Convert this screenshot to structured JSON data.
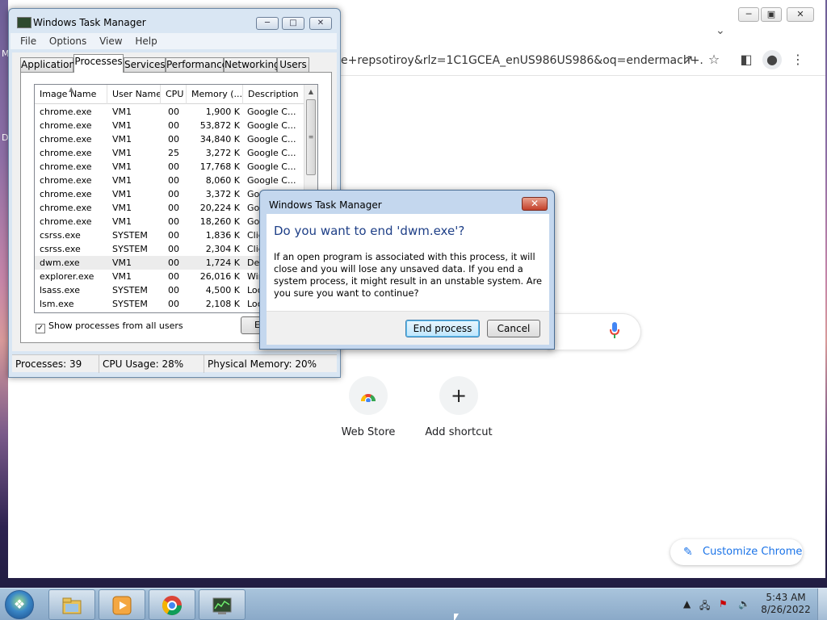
{
  "desktop": {
    "edge_letters": [
      "M",
      "D"
    ]
  },
  "chrome": {
    "address_text": "e+repsotiroy&rlz=1C1GCEA_enUS986US986&oq=endermach+...",
    "shortcuts": [
      {
        "label": "Web Store",
        "icon": "chrome-web-store-icon"
      },
      {
        "label": "Add shortcut",
        "icon": "plus-icon"
      }
    ],
    "customize_label": "Customize Chrome"
  },
  "taskmgr": {
    "title": "Windows Task Manager",
    "menu": [
      "File",
      "Options",
      "View",
      "Help"
    ],
    "tabs": [
      "Applications",
      "Processes",
      "Services",
      "Performance",
      "Networking",
      "Users"
    ],
    "active_tab": "Processes",
    "columns": [
      "Image Name",
      "User Name",
      "CPU",
      "Memory (...",
      "Description"
    ],
    "rows": [
      {
        "name": "chrome.exe",
        "user": "VM1",
        "cpu": "00",
        "mem": "1,900 K",
        "desc": "Google C..."
      },
      {
        "name": "chrome.exe",
        "user": "VM1",
        "cpu": "00",
        "mem": "53,872 K",
        "desc": "Google C..."
      },
      {
        "name": "chrome.exe",
        "user": "VM1",
        "cpu": "00",
        "mem": "34,840 K",
        "desc": "Google C..."
      },
      {
        "name": "chrome.exe",
        "user": "VM1",
        "cpu": "25",
        "mem": "3,272 K",
        "desc": "Google C..."
      },
      {
        "name": "chrome.exe",
        "user": "VM1",
        "cpu": "00",
        "mem": "17,768 K",
        "desc": "Google C..."
      },
      {
        "name": "chrome.exe",
        "user": "VM1",
        "cpu": "00",
        "mem": "8,060 K",
        "desc": "Google C..."
      },
      {
        "name": "chrome.exe",
        "user": "VM1",
        "cpu": "00",
        "mem": "3,372 K",
        "desc": "Goo"
      },
      {
        "name": "chrome.exe",
        "user": "VM1",
        "cpu": "00",
        "mem": "20,224 K",
        "desc": "Goo"
      },
      {
        "name": "chrome.exe",
        "user": "VM1",
        "cpu": "00",
        "mem": "18,260 K",
        "desc": "Goo"
      },
      {
        "name": "csrss.exe",
        "user": "SYSTEM",
        "cpu": "00",
        "mem": "1,836 K",
        "desc": "Clie"
      },
      {
        "name": "csrss.exe",
        "user": "SYSTEM",
        "cpu": "00",
        "mem": "2,304 K",
        "desc": "Clie"
      },
      {
        "name": "dwm.exe",
        "user": "VM1",
        "cpu": "00",
        "mem": "1,724 K",
        "desc": "Des",
        "selected": true
      },
      {
        "name": "explorer.exe",
        "user": "VM1",
        "cpu": "00",
        "mem": "26,016 K",
        "desc": "Win"
      },
      {
        "name": "lsass.exe",
        "user": "SYSTEM",
        "cpu": "00",
        "mem": "4,500 K",
        "desc": "Loc"
      },
      {
        "name": "lsm.exe",
        "user": "SYSTEM",
        "cpu": "00",
        "mem": "2,108 K",
        "desc": "Loc"
      }
    ],
    "show_all_users_label": "Show processes from all users",
    "show_all_users_checked": true,
    "end_process_label": "E",
    "status": {
      "processes": "Processes: 39",
      "cpu": "CPU Usage: 28%",
      "memory": "Physical Memory: 20%"
    }
  },
  "dialog": {
    "title": "Windows Task Manager",
    "heading": "Do you want to end 'dwm.exe'?",
    "message": "If an open program is associated with this process, it will close and you will lose any unsaved data. If you end a system process, it might result in an unstable system. Are you sure you want to continue?",
    "confirm_label": "End process",
    "cancel_label": "Cancel"
  },
  "taskbar": {
    "pinned": [
      "windows-explorer-icon",
      "media-player-icon",
      "chrome-icon",
      "task-manager-icon"
    ],
    "time": "5:43 AM",
    "date": "8/26/2022"
  }
}
